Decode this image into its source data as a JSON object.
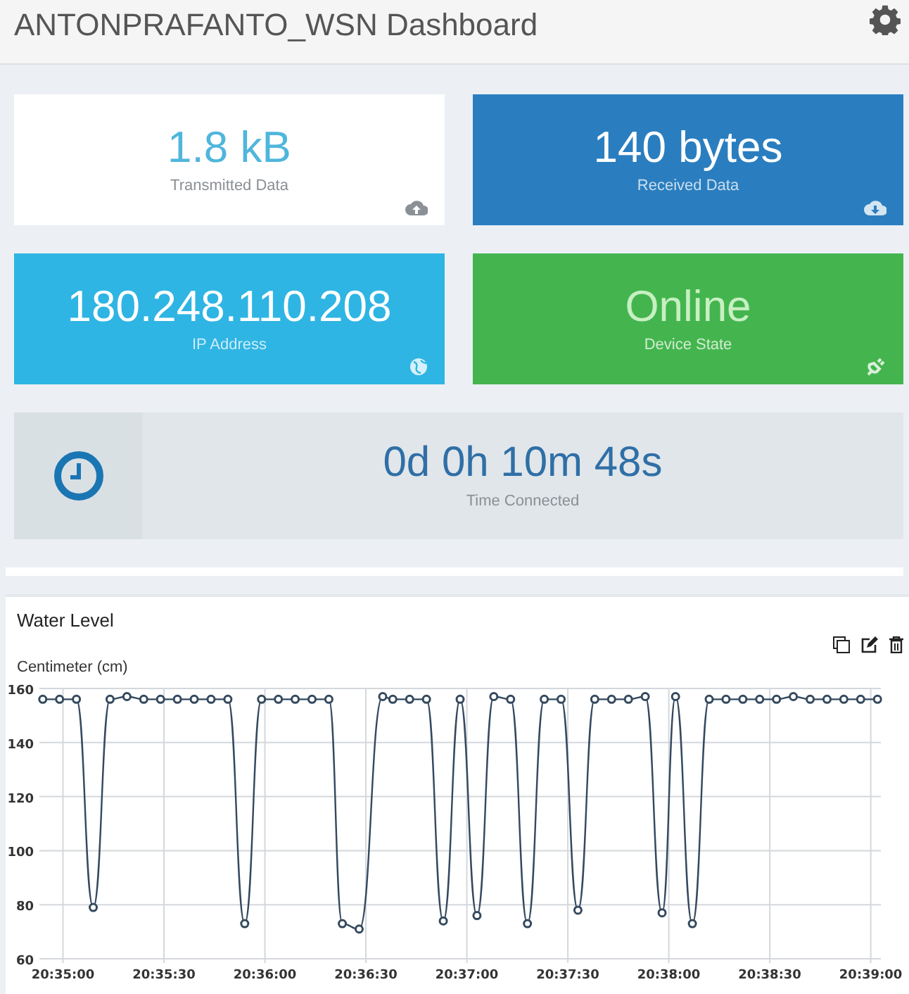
{
  "header": {
    "title": "ANTONPRAFANTO_WSN Dashboard"
  },
  "tiles": [
    {
      "value": "1.8 kB",
      "label": "Transmitted Data",
      "kind": "light",
      "color": "#ffffff"
    },
    {
      "value": "140 bytes",
      "label": "Received Data",
      "kind": "filled",
      "color": "#2a7ebf"
    },
    {
      "value": "180.248.110.208",
      "label": "IP Address",
      "kind": "filled",
      "color": "#2fb5e3"
    },
    {
      "value": "Online",
      "label": "Device State",
      "kind": "filled",
      "color": "#44b54e"
    }
  ],
  "timer": {
    "value": "0d 0h 10m 48s",
    "label": "Time Connected"
  },
  "chart_panel": {
    "chart_data": {
      "type": "line",
      "title": "Water Level",
      "ylabel": "Centimeter (cm)",
      "x": [
        74094,
        74099,
        74104,
        74109,
        74114,
        74119,
        74124,
        74129,
        74134,
        74139,
        74144,
        74149,
        74154,
        74159,
        74164,
        74169,
        74174,
        74179,
        74183,
        74188,
        74195,
        74198,
        74203,
        74208,
        74213,
        74218,
        74223,
        74228,
        74233,
        74238,
        74243,
        74248,
        74253,
        74258,
        74263,
        74268,
        74273,
        74278,
        74282,
        74287,
        74292,
        74297,
        74302,
        74307,
        74312,
        74317,
        74322,
        74327,
        74332,
        74337,
        74342
      ],
      "grid": true,
      "series": [
        {
          "marker": true,
          "color": "#34495e",
          "values": [
            156,
            156,
            156,
            79,
            156,
            157,
            156,
            156,
            156,
            156,
            156,
            156,
            73,
            156,
            156,
            156,
            156,
            156,
            73,
            71,
            157,
            156,
            156,
            156,
            74,
            156,
            76,
            157,
            156,
            73,
            156,
            156,
            78,
            156,
            156,
            156,
            157,
            77,
            157,
            73,
            156,
            156,
            156,
            156,
            156,
            157,
            156,
            156,
            156,
            156,
            156
          ]
        }
      ],
      "xlim": [
        74093,
        74343
      ],
      "ylim": [
        60,
        160
      ],
      "xticks": [
        {
          "value": 74100,
          "label": "20:35:00"
        },
        {
          "value": 74130,
          "label": "20:35:30"
        },
        {
          "value": 74160,
          "label": "20:36:00"
        },
        {
          "value": 74190,
          "label": "20:36:30"
        },
        {
          "value": 74220,
          "label": "20:37:00"
        },
        {
          "value": 74250,
          "label": "20:37:30"
        },
        {
          "value": 74280,
          "label": "20:38:00"
        },
        {
          "value": 74310,
          "label": "20:38:30"
        },
        {
          "value": 74340,
          "label": "20:39:00"
        }
      ],
      "yticks": [
        60,
        80,
        100,
        120,
        140,
        160
      ]
    }
  }
}
